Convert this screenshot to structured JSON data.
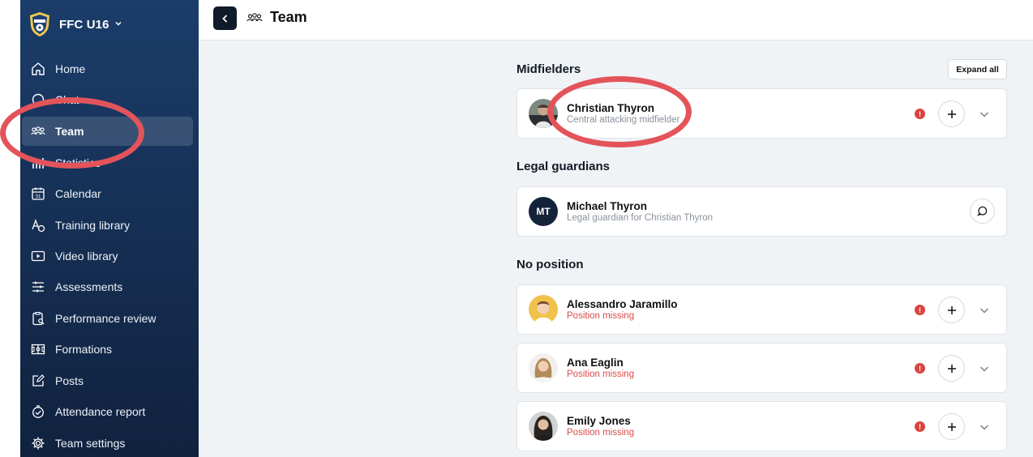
{
  "team_switcher": {
    "name": "FFC U16",
    "chevron_icon": "chevron-down-icon"
  },
  "sidebar": {
    "items": [
      {
        "label": "Home",
        "icon": "home-icon"
      },
      {
        "label": "Chat",
        "icon": "chat-icon"
      },
      {
        "label": "Team",
        "icon": "team-icon",
        "active": true
      },
      {
        "label": "Statistics",
        "icon": "statistics-icon"
      },
      {
        "label": "Calendar",
        "icon": "calendar-icon"
      },
      {
        "label": "Training library",
        "icon": "training-library-icon"
      },
      {
        "label": "Video library",
        "icon": "video-library-icon"
      },
      {
        "label": "Assessments",
        "icon": "assessments-icon"
      },
      {
        "label": "Performance review",
        "icon": "performance-review-icon"
      },
      {
        "label": "Formations",
        "icon": "formations-icon"
      },
      {
        "label": "Posts",
        "icon": "posts-icon"
      },
      {
        "label": "Attendance report",
        "icon": "attendance-report-icon"
      },
      {
        "label": "Team settings",
        "icon": "gear-icon"
      }
    ]
  },
  "header": {
    "title": "Team",
    "back_icon": "chevron-left-icon",
    "title_icon": "team-icon"
  },
  "main": {
    "expand_all_label": "Expand all",
    "sections": [
      {
        "title": "Midfielders",
        "members": [
          {
            "name": "Christian Thyron",
            "subtitle": "Central attacking midfielder",
            "warning": true
          }
        ]
      },
      {
        "title": "Legal guardians",
        "members": [
          {
            "name": "Michael Thyron",
            "initials": "MT",
            "subtitle": "Legal guardian for Christian Thyron"
          }
        ]
      },
      {
        "title": "No position",
        "members": [
          {
            "name": "Alessandro Jaramillo",
            "subtitle": "Position missing",
            "warning": true
          },
          {
            "name": "Ana Eaglin",
            "subtitle": "Position missing",
            "warning": true
          },
          {
            "name": "Emily Jones",
            "subtitle": "Position missing",
            "warning": true
          }
        ]
      }
    ],
    "alert_symbol": "!"
  },
  "colors": {
    "sidebar_top": "#1b3d6a",
    "sidebar_bottom": "#10223e",
    "warning": "#dd4a4a",
    "annotation": "#e3545a",
    "main_bg": "#f0f3f6"
  }
}
